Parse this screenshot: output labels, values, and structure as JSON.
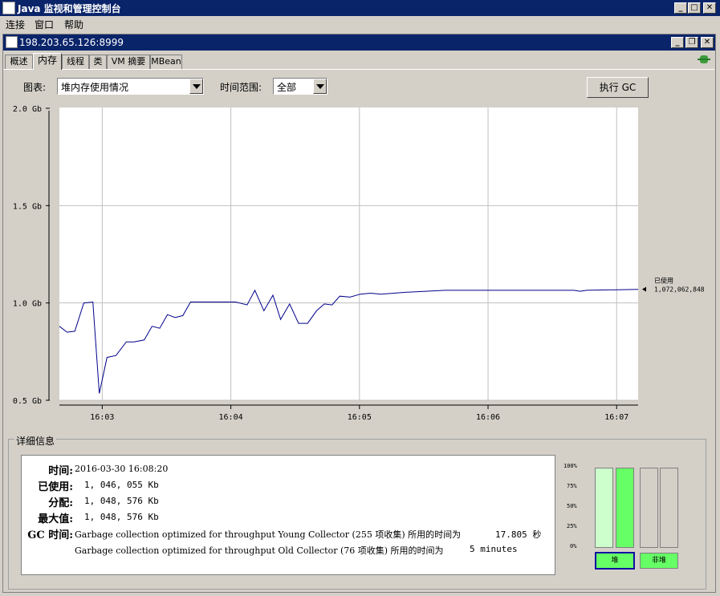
{
  "app": {
    "title": "Java 监视和管理控制台"
  },
  "menu": [
    "连接",
    "窗口",
    "帮助"
  ],
  "connection": {
    "title": "198.203.65.126:8999"
  },
  "tabs": [
    "概述",
    "内存",
    "线程",
    "类",
    "VM 摘要",
    "MBean"
  ],
  "selected_tab": "内存",
  "controls": {
    "chart_label": "图表:",
    "chart_value": "堆内存使用情况",
    "range_label": "时间范围:",
    "range_value": "全部",
    "gc_button": "执行 GC"
  },
  "chart_data": {
    "type": "line",
    "ylim": [
      0.5,
      2.0
    ],
    "y_ticks": [
      "2.0 Gb",
      "1.5 Gb",
      "1.0 Gb",
      "0.5 Gb"
    ],
    "x_ticks": [
      "16:03",
      "16:04",
      "16:05",
      "16:06",
      "16:07"
    ],
    "x_unit": "minutes since 16:02:40",
    "series": [
      {
        "name": "已使用",
        "x": [
          0.0,
          0.06,
          0.12,
          0.19,
          0.26,
          0.31,
          0.37,
          0.44,
          0.52,
          0.58,
          0.66,
          0.72,
          0.78,
          0.84,
          0.9,
          0.96,
          1.02,
          1.1,
          1.37,
          1.46,
          1.52,
          1.59,
          1.66,
          1.72,
          1.79,
          1.86,
          1.93,
          2.0,
          2.06,
          2.12,
          2.18,
          2.26,
          2.34,
          2.42,
          2.5,
          2.6,
          2.7,
          2.85,
          3.0,
          3.2,
          3.5,
          3.8,
          4.0,
          4.05,
          4.1,
          4.5
        ],
        "values": [
          0.88,
          0.85,
          0.855,
          1.0,
          1.005,
          0.535,
          0.72,
          0.73,
          0.8,
          0.8,
          0.81,
          0.88,
          0.87,
          0.94,
          0.925,
          0.935,
          1.005,
          1.005,
          1.005,
          0.99,
          1.065,
          0.96,
          1.04,
          0.915,
          0.995,
          0.895,
          0.895,
          0.96,
          0.995,
          0.99,
          1.035,
          1.03,
          1.045,
          1.05,
          1.045,
          1.05,
          1.055,
          1.06,
          1.065,
          1.065,
          1.065,
          1.065,
          1.065,
          1.06,
          1.065,
          1.07
        ]
      }
    ],
    "marker_label": "已使用",
    "marker_value": "1,072,062,848"
  },
  "details": {
    "title": "详细信息",
    "rows": [
      {
        "key": "时间:",
        "value": "2016-03-30 16:08:20"
      },
      {
        "key": "已使用:",
        "value": "1, 046, 055 Kb"
      },
      {
        "key": "分配:",
        "value": "1, 048, 576 Kb"
      },
      {
        "key": "最大值:",
        "value": "1, 048, 576 Kb"
      }
    ],
    "gc_key": "GC 时间:",
    "gc_lines": [
      {
        "text": "Garbage collection optimized for throughput Young Collector (255 项收集) 所用的时间为",
        "time": "17.805 秒"
      },
      {
        "text": "Garbage collection optimized for throughput Old Collector (76 项收集) 所用的时间为",
        "time": "5 minutes"
      }
    ]
  },
  "memory_bars": {
    "pct_labels": [
      "100%",
      "75%",
      "50%",
      "25%",
      "0%"
    ],
    "heap_label": "堆",
    "nonheap_label": "非堆",
    "heap_used": 1.0,
    "heap_committed": 1.0,
    "nonheap_used": 0.0,
    "colors": {
      "used": "#66ff66",
      "committed": "#ccffcc"
    }
  }
}
